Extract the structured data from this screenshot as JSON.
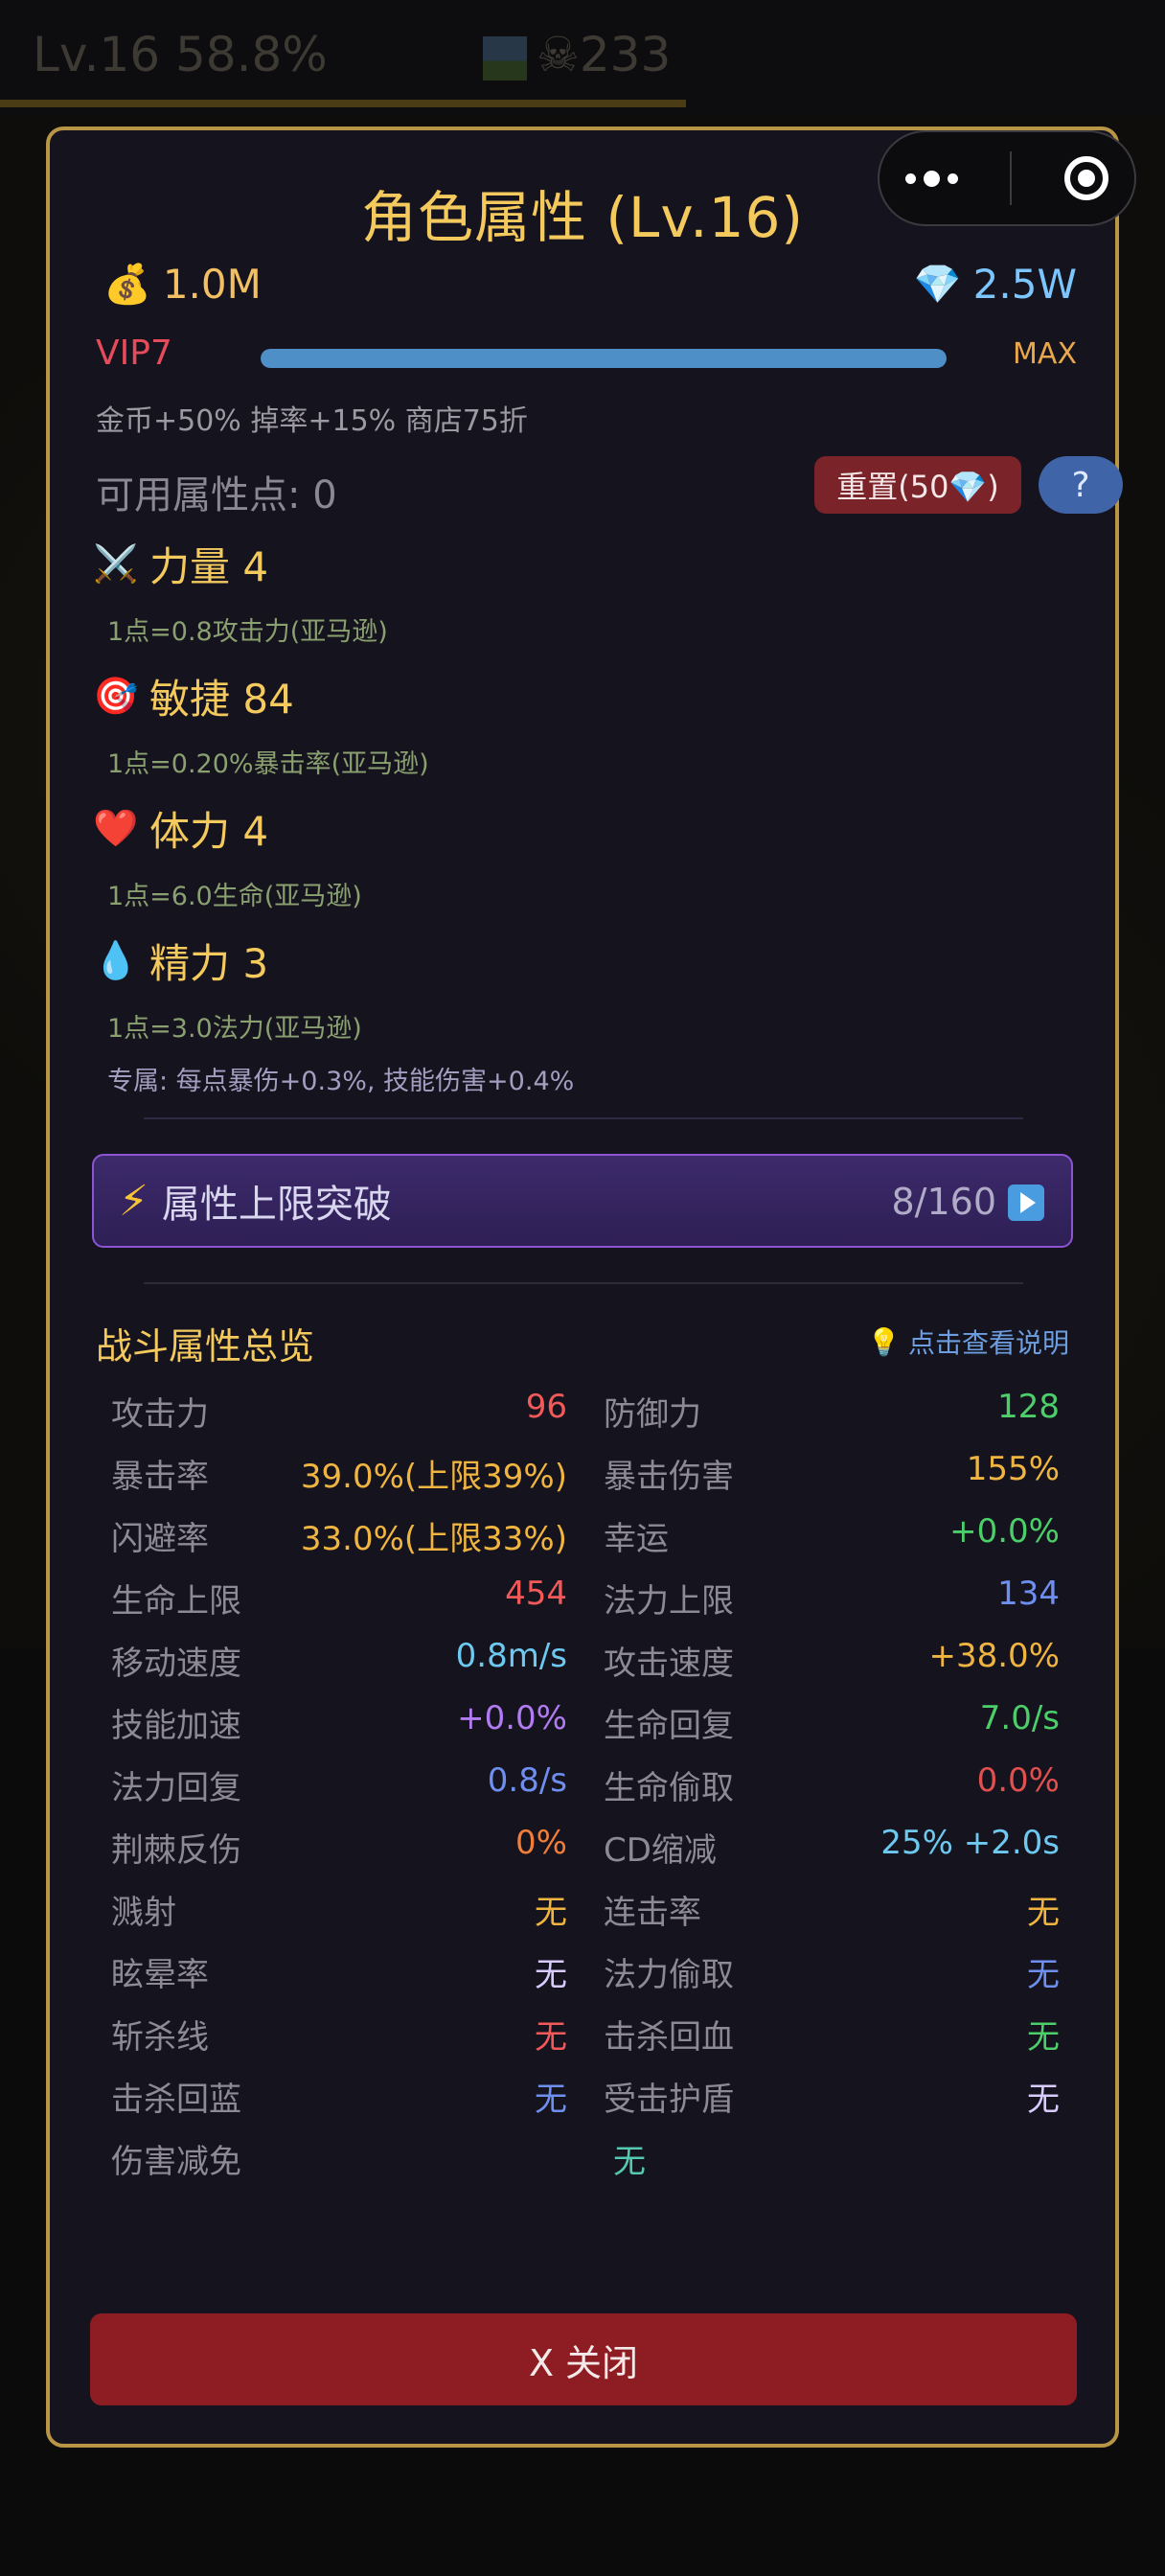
{
  "background": {
    "level_text": "Lv.16 58.8%",
    "skull_count": "233"
  },
  "modal": {
    "title": "角色属性 (Lv.16)",
    "gold": "1.0M",
    "gems": "2.5W",
    "vip": {
      "label": "VIP7",
      "progress": 1.0,
      "max_label": "MAX",
      "bonus": "金币+50% 掉率+15% 商店75折"
    },
    "points": {
      "label": "可用属性点: 0",
      "reset_label": "重置(50💎)",
      "help_label": "?"
    },
    "attributes": [
      {
        "icon": "⚔️",
        "name": "力量 4",
        "desc": "1点=0.8攻击力(亚马逊)"
      },
      {
        "icon": "🎯",
        "name": "敏捷 84",
        "desc": "1点=0.20%暴击率(亚马逊)"
      },
      {
        "icon": "❤️",
        "name": "体力 4",
        "desc": "1点=6.0生命(亚马逊)"
      },
      {
        "icon": "💧",
        "name": "精力 3",
        "desc": "1点=3.0法力(亚马逊)",
        "extra": "专属: 每点暴伤+0.3%, 技能伤害+0.4%"
      }
    ],
    "breakthrough": {
      "label": "属性上限突破",
      "count": "8/160"
    },
    "stats_title": "战斗属性总览",
    "stats_hint": "点击查看说明",
    "stats": [
      [
        {
          "label": "攻击力",
          "value": "96",
          "color": "#f25a5a"
        },
        {
          "label": "防御力",
          "value": "128",
          "color": "#4ccf6a"
        }
      ],
      [
        {
          "label": "暴击率",
          "value": "39.0%(上限39%)",
          "color": "#f0b540"
        },
        {
          "label": "暴击伤害",
          "value": "155%",
          "color": "#f0b540"
        }
      ],
      [
        {
          "label": "闪避率",
          "value": "33.0%(上限33%)",
          "color": "#f0b540"
        },
        {
          "label": "幸运",
          "value": "+0.0%",
          "color": "#4ccf6a"
        }
      ],
      [
        {
          "label": "生命上限",
          "value": "454",
          "color": "#f25a5a"
        },
        {
          "label": "法力上限",
          "value": "134",
          "color": "#6f8ff0"
        }
      ],
      [
        {
          "label": "移动速度",
          "value": "0.8m/s",
          "color": "#6ec9f0"
        },
        {
          "label": "攻击速度",
          "value": "+38.0%",
          "color": "#f0b540"
        }
      ],
      [
        {
          "label": "技能加速",
          "value": "+0.0%",
          "color": "#b17cf2"
        },
        {
          "label": "生命回复",
          "value": "7.0/s",
          "color": "#4ccf6a"
        }
      ],
      [
        {
          "label": "法力回复",
          "value": "0.8/s",
          "color": "#6f8ff0"
        },
        {
          "label": "生命偷取",
          "value": "0.0%",
          "color": "#e0504f"
        }
      ],
      [
        {
          "label": "荆棘反伤",
          "value": "0%",
          "color": "#f07d3a"
        },
        {
          "label": "CD缩减",
          "value": "25% +2.0s",
          "color": "#6ec9f0"
        }
      ],
      [
        {
          "label": "溅射",
          "value": "无",
          "color": "#f0b540"
        },
        {
          "label": "连击率",
          "value": "无",
          "color": "#f0b540"
        }
      ],
      [
        {
          "label": "眩晕率",
          "value": "无",
          "color": "#d8ccff"
        },
        {
          "label": "法力偷取",
          "value": "无",
          "color": "#6f8ff0"
        }
      ],
      [
        {
          "label": "斩杀线",
          "value": "无",
          "color": "#f25a5a"
        },
        {
          "label": "击杀回血",
          "value": "无",
          "color": "#4ccf6a"
        }
      ],
      [
        {
          "label": "击杀回蓝",
          "value": "无",
          "color": "#6f8ff0"
        },
        {
          "label": "受击护盾",
          "value": "无",
          "color": "#d8ccff"
        }
      ],
      [
        {
          "label": "伤害减免",
          "value": "无",
          "color": "#54c8b0"
        }
      ]
    ],
    "close_label": "X  关闭"
  }
}
